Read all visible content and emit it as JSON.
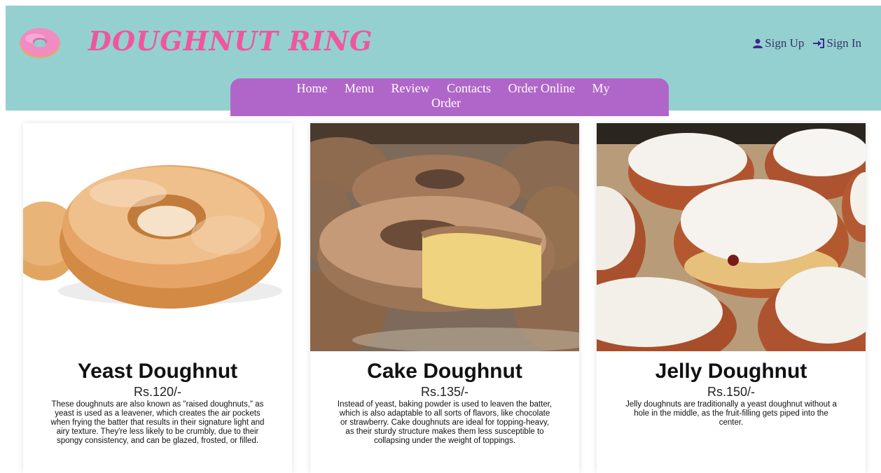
{
  "header": {
    "brand": "DOUGHNUT RING",
    "auth": {
      "signup_label": "Sign Up",
      "signin_label": "Sign In"
    },
    "nav": {
      "home": "Home",
      "menu": "Menu",
      "review": "Review",
      "contacts": "Contacts",
      "order_online": "Order Online",
      "my_order_line1": "My",
      "my_order_line2": "Order"
    }
  },
  "colors": {
    "header_bg": "#95d0d0",
    "brand": "#f0569e",
    "nav_bg": "#b066c8"
  },
  "products": [
    {
      "title": "Yeast Doughnut",
      "price": "Rs.120/-",
      "description": "These doughnuts are also known as \"raised doughnuts,\" as yeast is used as a leavener, which creates the air pockets when frying the batter that results in their signature light and airy texture. They're less likely to be crumbly, due to their spongy consistency, and can be glazed, frosted, or filled."
    },
    {
      "title": "Cake Doughnut",
      "price": "Rs.135/-",
      "description": "Instead of yeast, baking powder is used to leaven the batter, which is also adaptable to all sorts of flavors, like chocolate or strawberry. Cake doughnuts are ideal for topping-heavy, as their sturdy structure makes them less susceptible to collapsing under the weight of toppings."
    },
    {
      "title": "Jelly Doughnut",
      "price": "Rs.150/-",
      "description": "Jelly doughnuts are traditionally a yeast doughnut without a hole in the middle, as the fruit-filling gets piped into the center."
    }
  ]
}
